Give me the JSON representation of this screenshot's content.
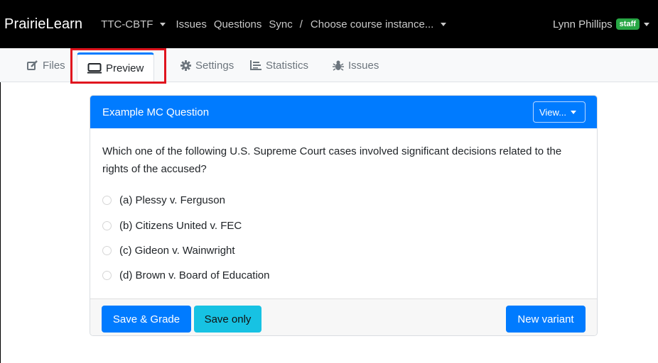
{
  "navbar": {
    "brand": "PrairieLearn",
    "course": "TTC-CBTF",
    "links": [
      "Issues",
      "Questions",
      "Sync"
    ],
    "separator": "/",
    "instance_selector": "Choose course instance...",
    "user_name": "Lynn Phillips",
    "user_badge": "staff"
  },
  "tabs": [
    {
      "label": "Files",
      "icon": "edit-icon"
    },
    {
      "label": "Preview",
      "icon": "monitor-icon",
      "active": true
    },
    {
      "label": "Settings",
      "icon": "gear-icon"
    },
    {
      "label": "Statistics",
      "icon": "bar-chart-icon"
    },
    {
      "label": "Issues",
      "icon": "bug-icon"
    }
  ],
  "question_card": {
    "title": "Example MC Question",
    "view_button": "View...",
    "question_text": "Which one of the following U.S. Supreme Court cases involved significant decisions related to the rights of the accused?",
    "options": [
      "(a) Plessy v. Ferguson",
      "(b) Citizens United v. FEC",
      "(c) Gideon v. Wainwright",
      "(d) Brown v. Board of Education"
    ],
    "buttons": {
      "save_grade": "Save & Grade",
      "save_only": "Save only",
      "new_variant": "New variant"
    }
  },
  "colors": {
    "primary": "#007bff",
    "info": "#17c2e3",
    "badge": "#28a745",
    "highlight": "#e0141e"
  }
}
